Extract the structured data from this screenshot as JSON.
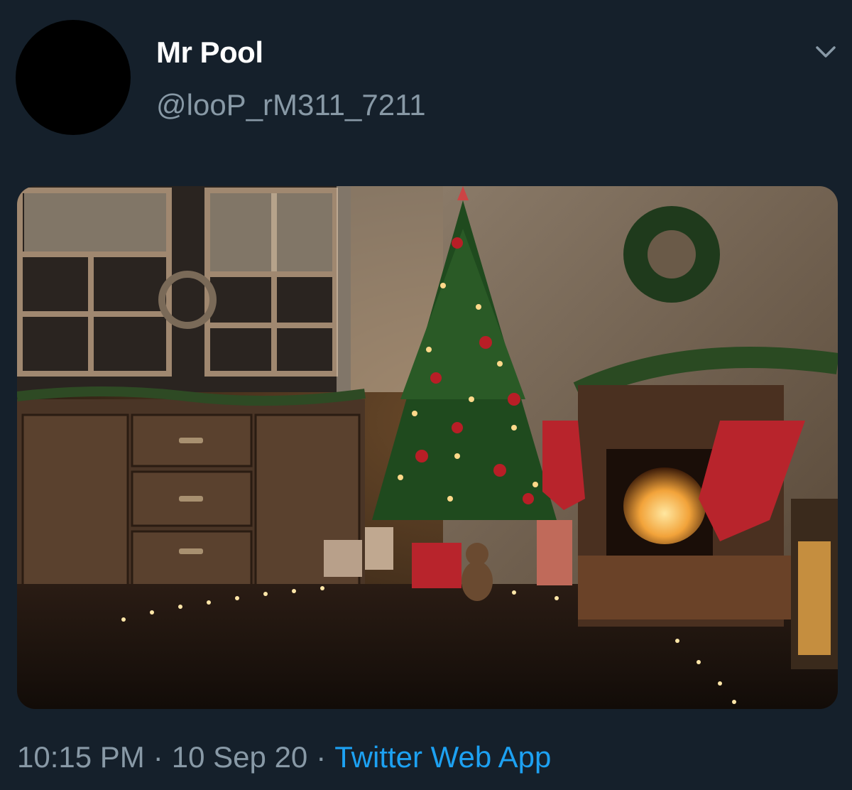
{
  "tweet": {
    "display_name": "Mr Pool",
    "handle": "@looP_rM311_7211",
    "time": "10:15 PM",
    "date": "10 Sep 20",
    "separator": "·",
    "source": "Twitter Web App",
    "menu_icon": "chevron-down-icon"
  },
  "colors": {
    "background": "#15202b",
    "name": "#ffffff",
    "secondary": "#8899a6",
    "link": "#1da1f2"
  }
}
